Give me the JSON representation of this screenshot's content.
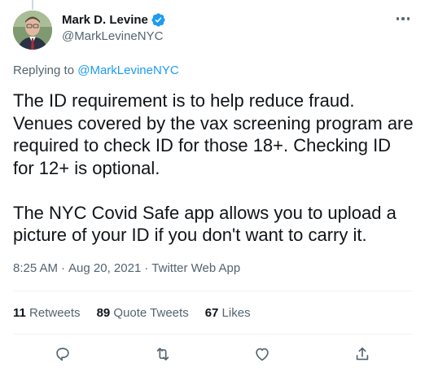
{
  "author": {
    "display_name": "Mark D. Levine",
    "handle": "@MarkLevineNYC",
    "verified": true
  },
  "reply": {
    "prefix": "Replying to ",
    "mention": "@MarkLevineNYC"
  },
  "tweet": {
    "text": "The ID requirement is to help reduce fraud. Venues covered by the vax screening program are required to check ID for those 18+. Checking ID for 12+ is optional.\n\nThe NYC Covid Safe app allows you to upload a picture of your ID if you don't want to carry it."
  },
  "meta": {
    "time": "8:25 AM",
    "separator": "·",
    "date": "Aug 20, 2021",
    "source": "Twitter Web App"
  },
  "stats": {
    "retweets_count": "11",
    "retweets_label": " Retweets",
    "quotes_count": "89",
    "quotes_label": " Quote Tweets",
    "likes_count": "67",
    "likes_label": " Likes"
  },
  "icons": {
    "verified": "verified-badge-icon",
    "more": "more-icon",
    "reply": "reply-icon",
    "retweet": "retweet-icon",
    "like": "heart-icon",
    "share": "share-icon"
  },
  "colors": {
    "accent": "#1d9bf0",
    "secondary_text": "#536471",
    "primary_text": "#0f1419",
    "divider": "#eff3f4"
  }
}
